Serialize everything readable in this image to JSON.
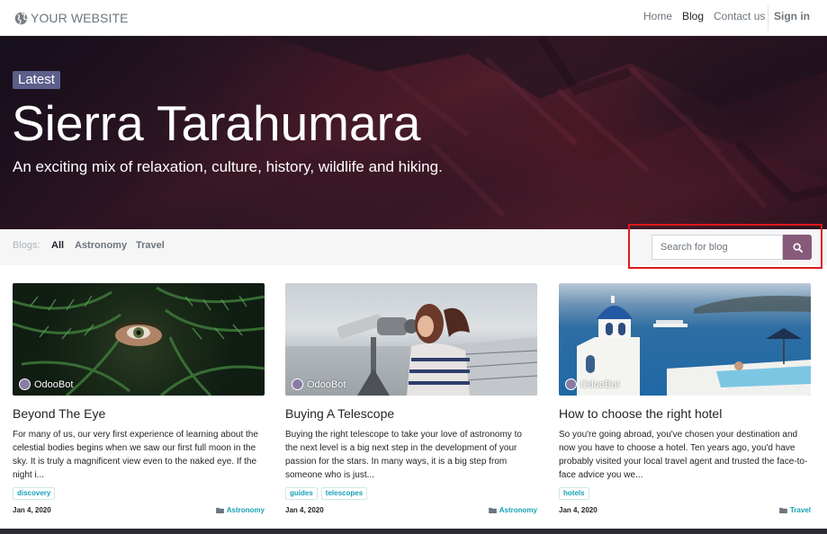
{
  "header": {
    "logo_text": "YOUR WEBSITE",
    "nav": [
      {
        "label": "Home",
        "active": false
      },
      {
        "label": "Blog",
        "active": true
      },
      {
        "label": "Contact us",
        "active": false
      }
    ],
    "signin_label": "Sign in"
  },
  "hero": {
    "badge": "Latest",
    "title": "Sierra Tarahumara",
    "subtitle": "An exciting mix of relaxation, culture, history, wildlife and hiking."
  },
  "filters": {
    "label": "Blogs:",
    "tabs": [
      "All",
      "Astronomy",
      "Travel"
    ],
    "active_tab": "All",
    "search_placeholder": "Search for blog",
    "search_icon": "search-icon",
    "accent_color": "#875a7b"
  },
  "posts": [
    {
      "author": "OdooBot",
      "title": "Beyond The Eye",
      "excerpt": "For many of us, our very first experience of learning about the celestial bodies begins when we saw our first full moon in the sky. It is truly a magnificent view even to the naked eye. If the night i...",
      "tags": [
        "discovery"
      ],
      "date": "Jan 4, 2020",
      "category": "Astronomy"
    },
    {
      "author": "OdooBot",
      "title": "Buying A Telescope",
      "excerpt": "Buying the right telescope to take your love of astronomy to the next level is a big next step in the development of your passion for the stars. In many ways, it is a big step from someone who is just...",
      "tags": [
        "guides",
        "telescopes"
      ],
      "date": "Jan 4, 2020",
      "category": "Astronomy"
    },
    {
      "author": "OdooBot",
      "title": "How to choose the right hotel",
      "excerpt": "So you're going abroad, you've chosen your destination and now you have to choose a hotel. Ten years ago, you'd have probably visited your local travel agent and trusted the face-to-face advice you we...",
      "tags": [
        "hotels"
      ],
      "date": "Jan 4, 2020",
      "category": "Travel"
    }
  ]
}
